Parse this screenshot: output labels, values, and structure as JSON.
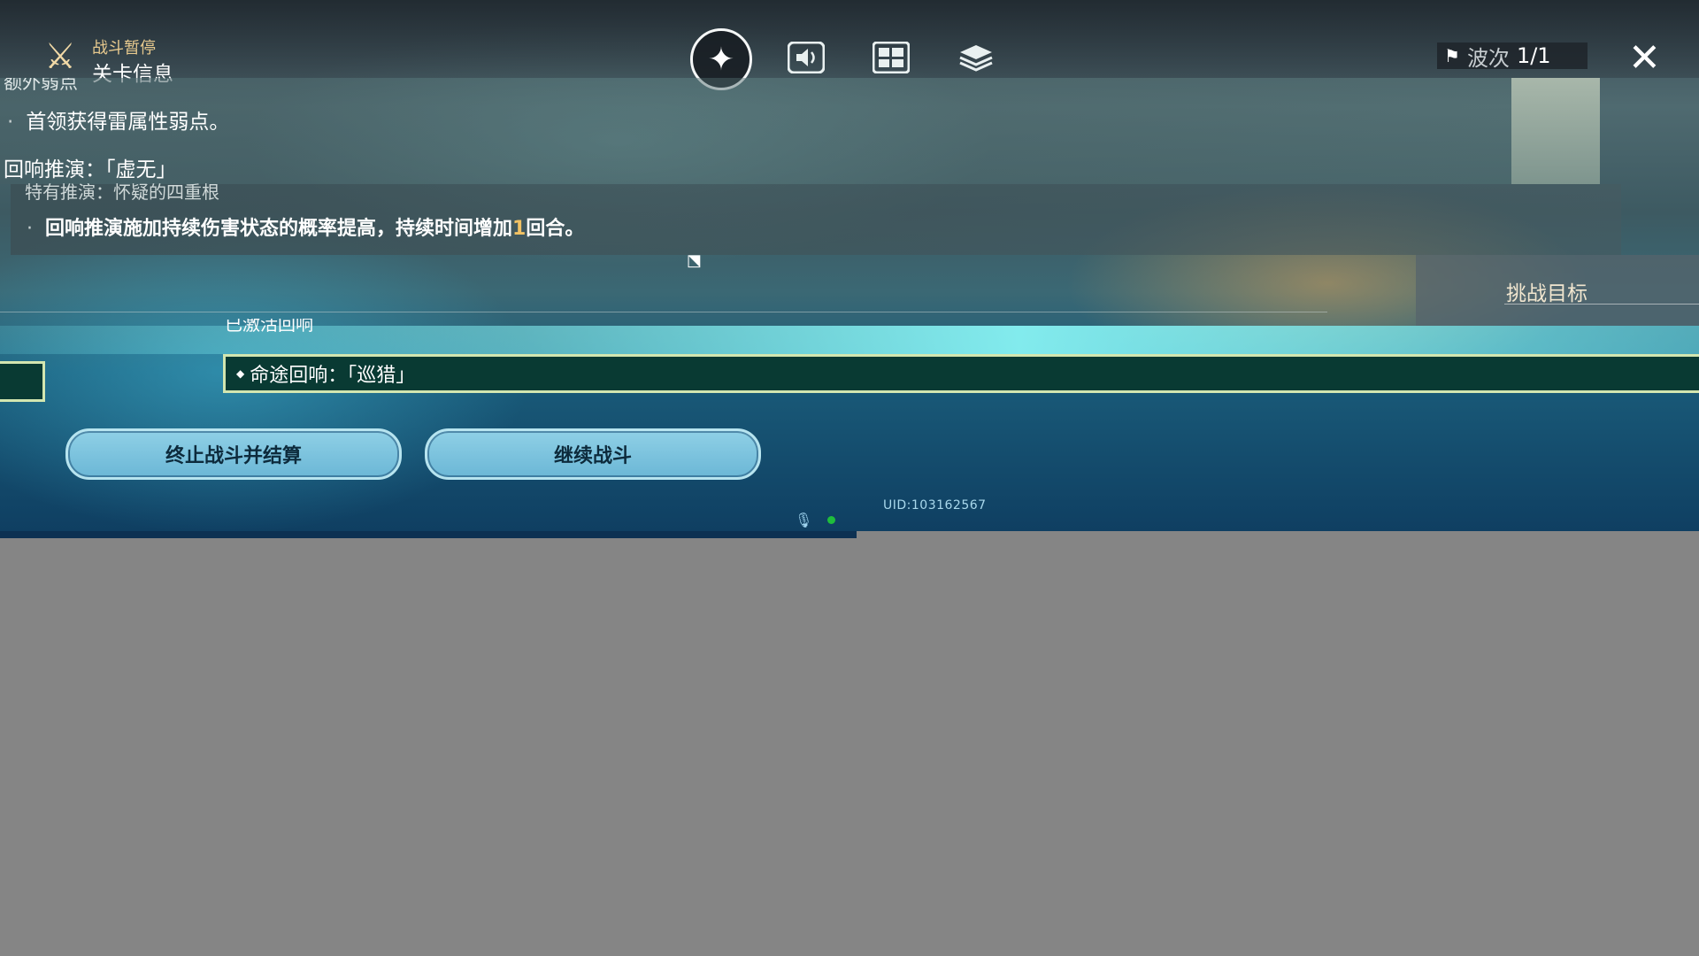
{
  "topbar": {
    "pause_label": "战斗暂停",
    "stage_label": "关卡信息",
    "wave_label": "波次",
    "wave_value": "1/1",
    "icons": [
      "crossed-swords-icon",
      "compass-icon",
      "sound-icon",
      "layout-icon",
      "layers-icon",
      "flag-icon",
      "close-icon"
    ]
  },
  "info": {
    "cut_top": "额外弱点",
    "weakness_line": "首领获得雷属性弱点。",
    "echo_title": "回响推演：「虚无」",
    "cut_mid": "特有推演：怀疑的四重根",
    "echo_desc_before": "回响推演施加持续伤害状态的概率提高，持续时间增加",
    "echo_desc_number": "1",
    "echo_desc_after": "回合。",
    "cut_activated": "已激活回响",
    "path_echo": "命途回响：「巡猎」"
  },
  "challenge": {
    "title": "挑战目标"
  },
  "buttons": {
    "end_battle": "终止战斗并结算",
    "continue_battle": "继续战斗"
  },
  "footer": {
    "uid": "UID:103162567"
  },
  "colors": {
    "accent_gold": "#f2c264",
    "button_blue": "#7fc4df",
    "panel_teal": "#093a33",
    "background_gray": "#858585"
  }
}
